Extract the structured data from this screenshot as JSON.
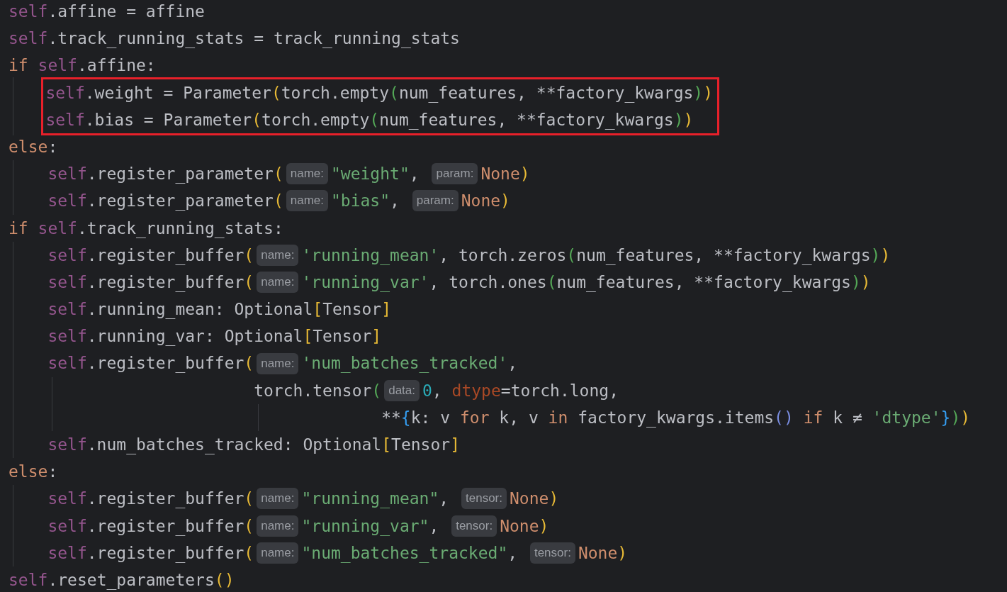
{
  "lines": [
    {
      "tokens": [
        {
          "kind": "self",
          "text": "self"
        },
        {
          "kind": "text",
          "text": ".affine = affine"
        }
      ]
    },
    {
      "tokens": [
        {
          "kind": "self",
          "text": "self"
        },
        {
          "kind": "text",
          "text": ".track_running_stats = track_running_stats"
        }
      ]
    },
    {
      "tokens": [
        {
          "kind": "keyword",
          "text": "if "
        },
        {
          "kind": "self",
          "text": "self"
        },
        {
          "kind": "text",
          "text": ".affine:"
        }
      ],
      "children": [
        {
          "kind": "statement",
          "boxed": true,
          "tokens": [
            {
              "kind": "self",
              "text": "self"
            },
            {
              "kind": "text",
              "text": ".weight = Parameter"
            },
            {
              "kind": "bracket1",
              "text": "("
            },
            {
              "kind": "text",
              "text": "torch.empty"
            },
            {
              "kind": "bracket2",
              "text": "("
            },
            {
              "kind": "text",
              "text": "num_features, **factory_kwargs"
            },
            {
              "kind": "bracket2",
              "text": ")"
            },
            {
              "kind": "bracket1",
              "text": ")"
            }
          ]
        },
        {
          "kind": "statement",
          "boxed": true,
          "tokens": [
            {
              "kind": "self",
              "text": "self"
            },
            {
              "kind": "text",
              "text": ".bias = Parameter"
            },
            {
              "kind": "bracket1",
              "text": "("
            },
            {
              "kind": "text",
              "text": "torch.empty"
            },
            {
              "kind": "bracket2",
              "text": "("
            },
            {
              "kind": "text",
              "text": "num_features, **factory_kwargs"
            },
            {
              "kind": "bracket2",
              "text": ")"
            },
            {
              "kind": "bracket1",
              "text": ")"
            }
          ]
        }
      ]
    },
    {
      "tokens": [
        {
          "kind": "keyword",
          "text": "else"
        },
        {
          "kind": "text",
          "text": ":"
        }
      ],
      "children": [
        {
          "kind": "statement",
          "tokens": [
            {
              "kind": "self",
              "text": "self"
            },
            {
              "kind": "text",
              "text": ".register_parameter"
            },
            {
              "kind": "bracket1",
              "text": "("
            },
            {
              "kind": "hint",
              "text": "name:"
            },
            {
              "kind": "string",
              "text": "\"weight\""
            },
            {
              "kind": "text",
              "text": ", "
            },
            {
              "kind": "hint",
              "text": "param:"
            },
            {
              "kind": "keyword",
              "text": "None"
            },
            {
              "kind": "bracket1",
              "text": ")"
            }
          ]
        },
        {
          "kind": "statement",
          "tokens": [
            {
              "kind": "self",
              "text": "self"
            },
            {
              "kind": "text",
              "text": ".register_parameter"
            },
            {
              "kind": "bracket1",
              "text": "("
            },
            {
              "kind": "hint",
              "text": "name:"
            },
            {
              "kind": "string",
              "text": "\"bias\""
            },
            {
              "kind": "text",
              "text": ", "
            },
            {
              "kind": "hint",
              "text": "param:"
            },
            {
              "kind": "keyword",
              "text": "None"
            },
            {
              "kind": "bracket1",
              "text": ")"
            }
          ]
        }
      ]
    },
    {
      "tokens": [
        {
          "kind": "keyword",
          "text": "if "
        },
        {
          "kind": "self",
          "text": "self"
        },
        {
          "kind": "text",
          "text": ".track_running_stats:"
        }
      ],
      "children": [
        {
          "kind": "statement",
          "tokens": [
            {
              "kind": "self",
              "text": "self"
            },
            {
              "kind": "text",
              "text": ".register_buffer"
            },
            {
              "kind": "bracket1",
              "text": "("
            },
            {
              "kind": "hint",
              "text": "name:"
            },
            {
              "kind": "string",
              "text": "'running_mean'"
            },
            {
              "kind": "text",
              "text": ", torch.zeros"
            },
            {
              "kind": "bracket2",
              "text": "("
            },
            {
              "kind": "text",
              "text": "num_features, **factory_kwargs"
            },
            {
              "kind": "bracket2",
              "text": ")"
            },
            {
              "kind": "bracket1",
              "text": ")"
            }
          ]
        },
        {
          "kind": "statement",
          "tokens": [
            {
              "kind": "self",
              "text": "self"
            },
            {
              "kind": "text",
              "text": ".register_buffer"
            },
            {
              "kind": "bracket1",
              "text": "("
            },
            {
              "kind": "hint",
              "text": "name:"
            },
            {
              "kind": "string",
              "text": "'running_var'"
            },
            {
              "kind": "text",
              "text": ", torch.ones"
            },
            {
              "kind": "bracket2",
              "text": "("
            },
            {
              "kind": "text",
              "text": "num_features, **factory_kwargs"
            },
            {
              "kind": "bracket2",
              "text": ")"
            },
            {
              "kind": "bracket1",
              "text": ")"
            }
          ]
        },
        {
          "kind": "statement",
          "tokens": [
            {
              "kind": "self",
              "text": "self"
            },
            {
              "kind": "text",
              "text": ".running_mean: Optional"
            },
            {
              "kind": "bracket1",
              "text": "["
            },
            {
              "kind": "text",
              "text": "Tensor"
            },
            {
              "kind": "bracket1",
              "text": "]"
            }
          ]
        },
        {
          "kind": "statement",
          "tokens": [
            {
              "kind": "self",
              "text": "self"
            },
            {
              "kind": "text",
              "text": ".running_var: Optional"
            },
            {
              "kind": "bracket1",
              "text": "["
            },
            {
              "kind": "text",
              "text": "Tensor"
            },
            {
              "kind": "bracket1",
              "text": "]"
            }
          ]
        },
        {
          "kind": "statement",
          "tokens": [
            {
              "kind": "self",
              "text": "self"
            },
            {
              "kind": "text",
              "text": ".register_buffer"
            },
            {
              "kind": "bracket1",
              "text": "("
            },
            {
              "kind": "hint",
              "text": "name:"
            },
            {
              "kind": "string",
              "text": "'num_batches_tracked'"
            },
            {
              "kind": "text",
              "text": ","
            }
          ],
          "children": [
            {
              "kind": "continuation",
              "tokens": [
                {
                  "kind": "text",
                  "text": "torch.tensor"
                },
                {
                  "kind": "bracket2",
                  "text": "("
                },
                {
                  "kind": "hint",
                  "text": "data:"
                },
                {
                  "kind": "number",
                  "text": "0"
                },
                {
                  "kind": "text",
                  "text": ", "
                },
                {
                  "kind": "kwarg",
                  "text": "dtype"
                },
                {
                  "kind": "text",
                  "text": "=torch.long,"
                }
              ],
              "children": [
                {
                  "kind": "continuation",
                  "tokens": [
                    {
                      "kind": "text",
                      "text": "**"
                    },
                    {
                      "kind": "bracket3",
                      "text": "{"
                    },
                    {
                      "kind": "text",
                      "text": "k: v "
                    },
                    {
                      "kind": "keyword",
                      "text": "for"
                    },
                    {
                      "kind": "text",
                      "text": " k, v "
                    },
                    {
                      "kind": "keyword",
                      "text": "in"
                    },
                    {
                      "kind": "text",
                      "text": " factory_kwargs.items"
                    },
                    {
                      "kind": "bracket4",
                      "text": "()"
                    },
                    {
                      "kind": "keyword",
                      "text": " if"
                    },
                    {
                      "kind": "text",
                      "text": " k ≠ "
                    },
                    {
                      "kind": "string",
                      "text": "'dtype'"
                    },
                    {
                      "kind": "bracket3",
                      "text": "}"
                    },
                    {
                      "kind": "bracket2",
                      "text": ")"
                    },
                    {
                      "kind": "bracket1",
                      "text": ")"
                    }
                  ]
                }
              ]
            }
          ]
        },
        {
          "kind": "statement",
          "tokens": [
            {
              "kind": "self",
              "text": "self"
            },
            {
              "kind": "text",
              "text": ".num_batches_tracked: Optional"
            },
            {
              "kind": "bracket1",
              "text": "["
            },
            {
              "kind": "text",
              "text": "Tensor"
            },
            {
              "kind": "bracket1",
              "text": "]"
            }
          ]
        }
      ]
    },
    {
      "tokens": [
        {
          "kind": "keyword",
          "text": "else"
        },
        {
          "kind": "text",
          "text": ":"
        }
      ],
      "children": [
        {
          "kind": "statement",
          "tokens": [
            {
              "kind": "self",
              "text": "self"
            },
            {
              "kind": "text",
              "text": ".register_buffer"
            },
            {
              "kind": "bracket1",
              "text": "("
            },
            {
              "kind": "hint",
              "text": "name:"
            },
            {
              "kind": "string",
              "text": "\"running_mean\""
            },
            {
              "kind": "text",
              "text": ", "
            },
            {
              "kind": "hint",
              "text": "tensor:"
            },
            {
              "kind": "keyword",
              "text": "None"
            },
            {
              "kind": "bracket1",
              "text": ")"
            }
          ]
        },
        {
          "kind": "statement",
          "tokens": [
            {
              "kind": "self",
              "text": "self"
            },
            {
              "kind": "text",
              "text": ".register_buffer"
            },
            {
              "kind": "bracket1",
              "text": "("
            },
            {
              "kind": "hint",
              "text": "name:"
            },
            {
              "kind": "string",
              "text": "\"running_var\""
            },
            {
              "kind": "text",
              "text": ", "
            },
            {
              "kind": "hint",
              "text": "tensor:"
            },
            {
              "kind": "keyword",
              "text": "None"
            },
            {
              "kind": "bracket1",
              "text": ")"
            }
          ]
        },
        {
          "kind": "statement",
          "tokens": [
            {
              "kind": "self",
              "text": "self"
            },
            {
              "kind": "text",
              "text": ".register_buffer"
            },
            {
              "kind": "bracket1",
              "text": "("
            },
            {
              "kind": "hint",
              "text": "name:"
            },
            {
              "kind": "string",
              "text": "\"num_batches_tracked\""
            },
            {
              "kind": "text",
              "text": ", "
            },
            {
              "kind": "hint",
              "text": "tensor:"
            },
            {
              "kind": "keyword",
              "text": "None"
            },
            {
              "kind": "bracket1",
              "text": ")"
            }
          ]
        }
      ]
    },
    {
      "tokens": [
        {
          "kind": "self",
          "text": "self"
        },
        {
          "kind": "text",
          "text": ".reset_parameters"
        },
        {
          "kind": "bracket1",
          "text": "()"
        }
      ]
    }
  ]
}
